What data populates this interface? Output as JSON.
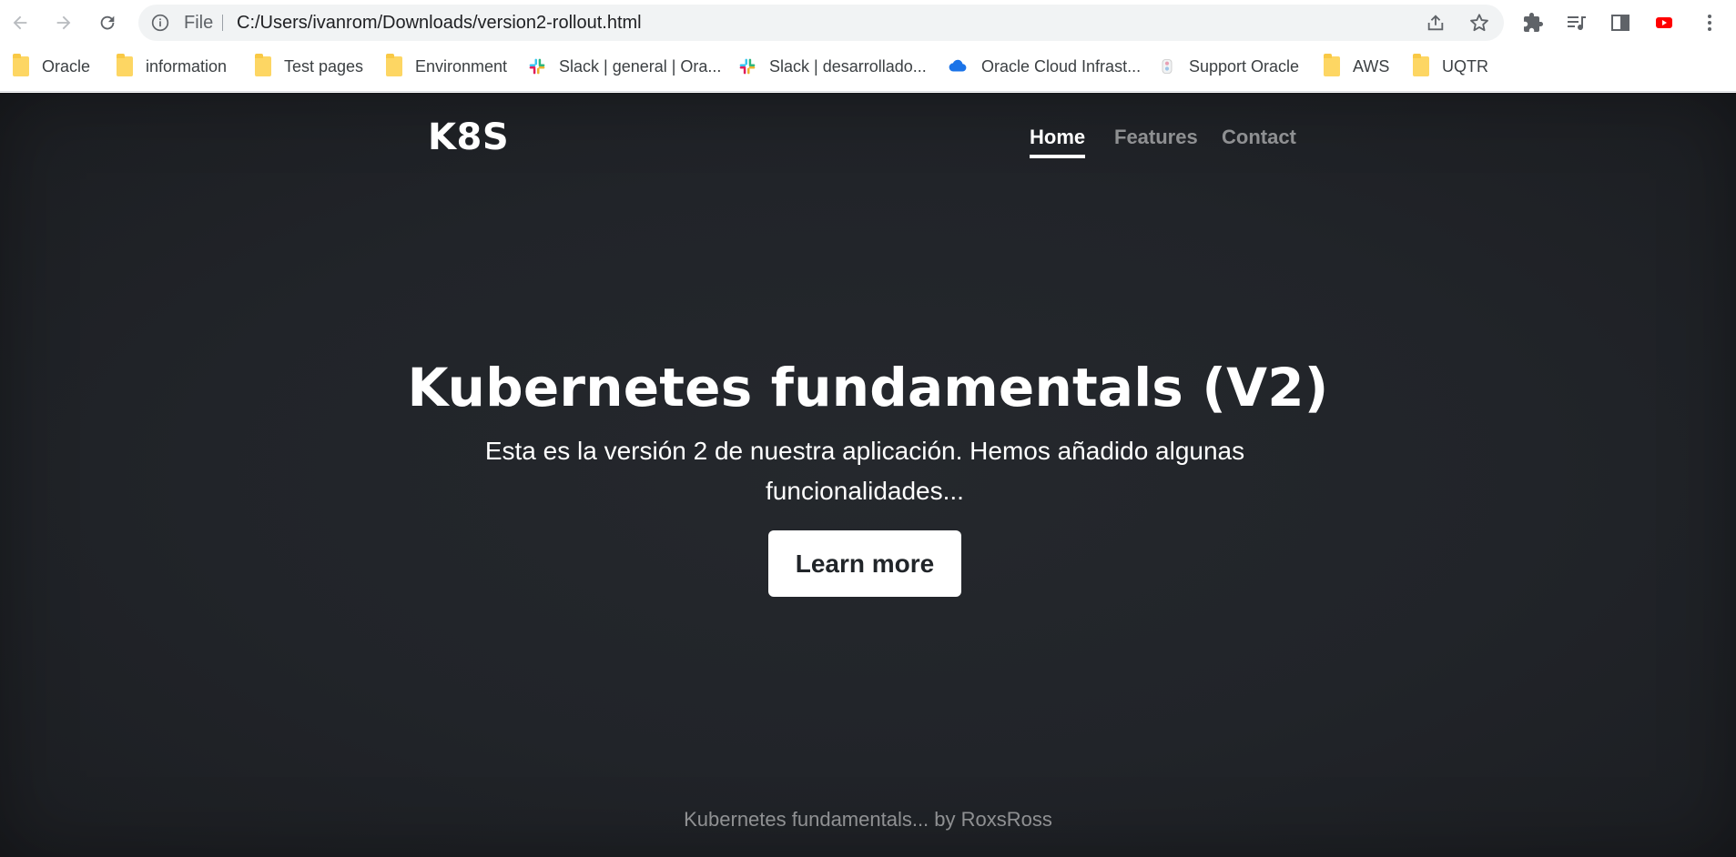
{
  "browser": {
    "omnibox": {
      "scheme_label": "File",
      "url": "C:/Users/ivanrom/Downloads/version2-rollout.html"
    },
    "bookmarks": [
      {
        "label": "Oracle",
        "icon": "folder-icon"
      },
      {
        "label": "information",
        "icon": "folder-icon"
      },
      {
        "label": "Test pages",
        "icon": "folder-icon"
      },
      {
        "label": "Environment",
        "icon": "folder-icon"
      },
      {
        "label": "Slack | general | Ora...",
        "icon": "slack-icon"
      },
      {
        "label": "Slack | desarrollado...",
        "icon": "slack-icon"
      },
      {
        "label": "Oracle Cloud Infrast...",
        "icon": "cloud-icon"
      },
      {
        "label": "Support Oracle",
        "icon": "support-icon"
      },
      {
        "label": "AWS",
        "icon": "folder-icon"
      },
      {
        "label": "UQTR",
        "icon": "folder-icon"
      }
    ]
  },
  "site": {
    "brand": "K8S",
    "nav": [
      {
        "label": "Home",
        "active": true
      },
      {
        "label": "Features",
        "active": false
      },
      {
        "label": "Contact",
        "active": false
      }
    ],
    "hero": {
      "title": "Kubernetes fundamentals (V2)",
      "subtitle": "Esta es la versión 2 de nuestra aplicación. Hemos añadido algunas funcionalidades...",
      "button_label": "Learn more"
    },
    "footer": "Kubernetes fundamentals... by RoxsRoss"
  },
  "colors": {
    "page_background": "#212429",
    "nav_inactive": "#8b8d90",
    "folder": "#fdd663",
    "youtube_red": "#ff0000"
  }
}
